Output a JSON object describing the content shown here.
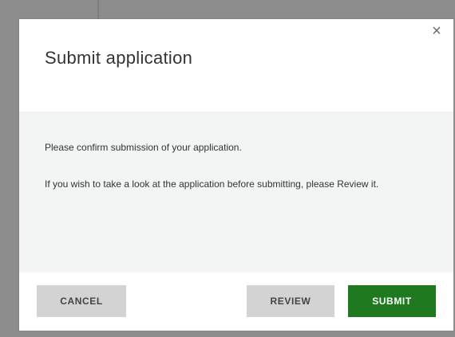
{
  "dialog": {
    "title": "Submit application",
    "close_icon": "close-icon",
    "close_glyph": "×",
    "body": {
      "paragraph1": "Please confirm submission of your application.",
      "paragraph2": "If you wish to take a look at the application before submitting, please Review it."
    },
    "buttons": {
      "cancel": "CANCEL",
      "review": "REVIEW",
      "submit": "SUBMIT"
    }
  },
  "colors": {
    "overlay": "#8c8c8c",
    "body_background": "#f3f5f4",
    "submit_button": "#1f7a1f",
    "secondary_button": "#d3d3d3"
  }
}
